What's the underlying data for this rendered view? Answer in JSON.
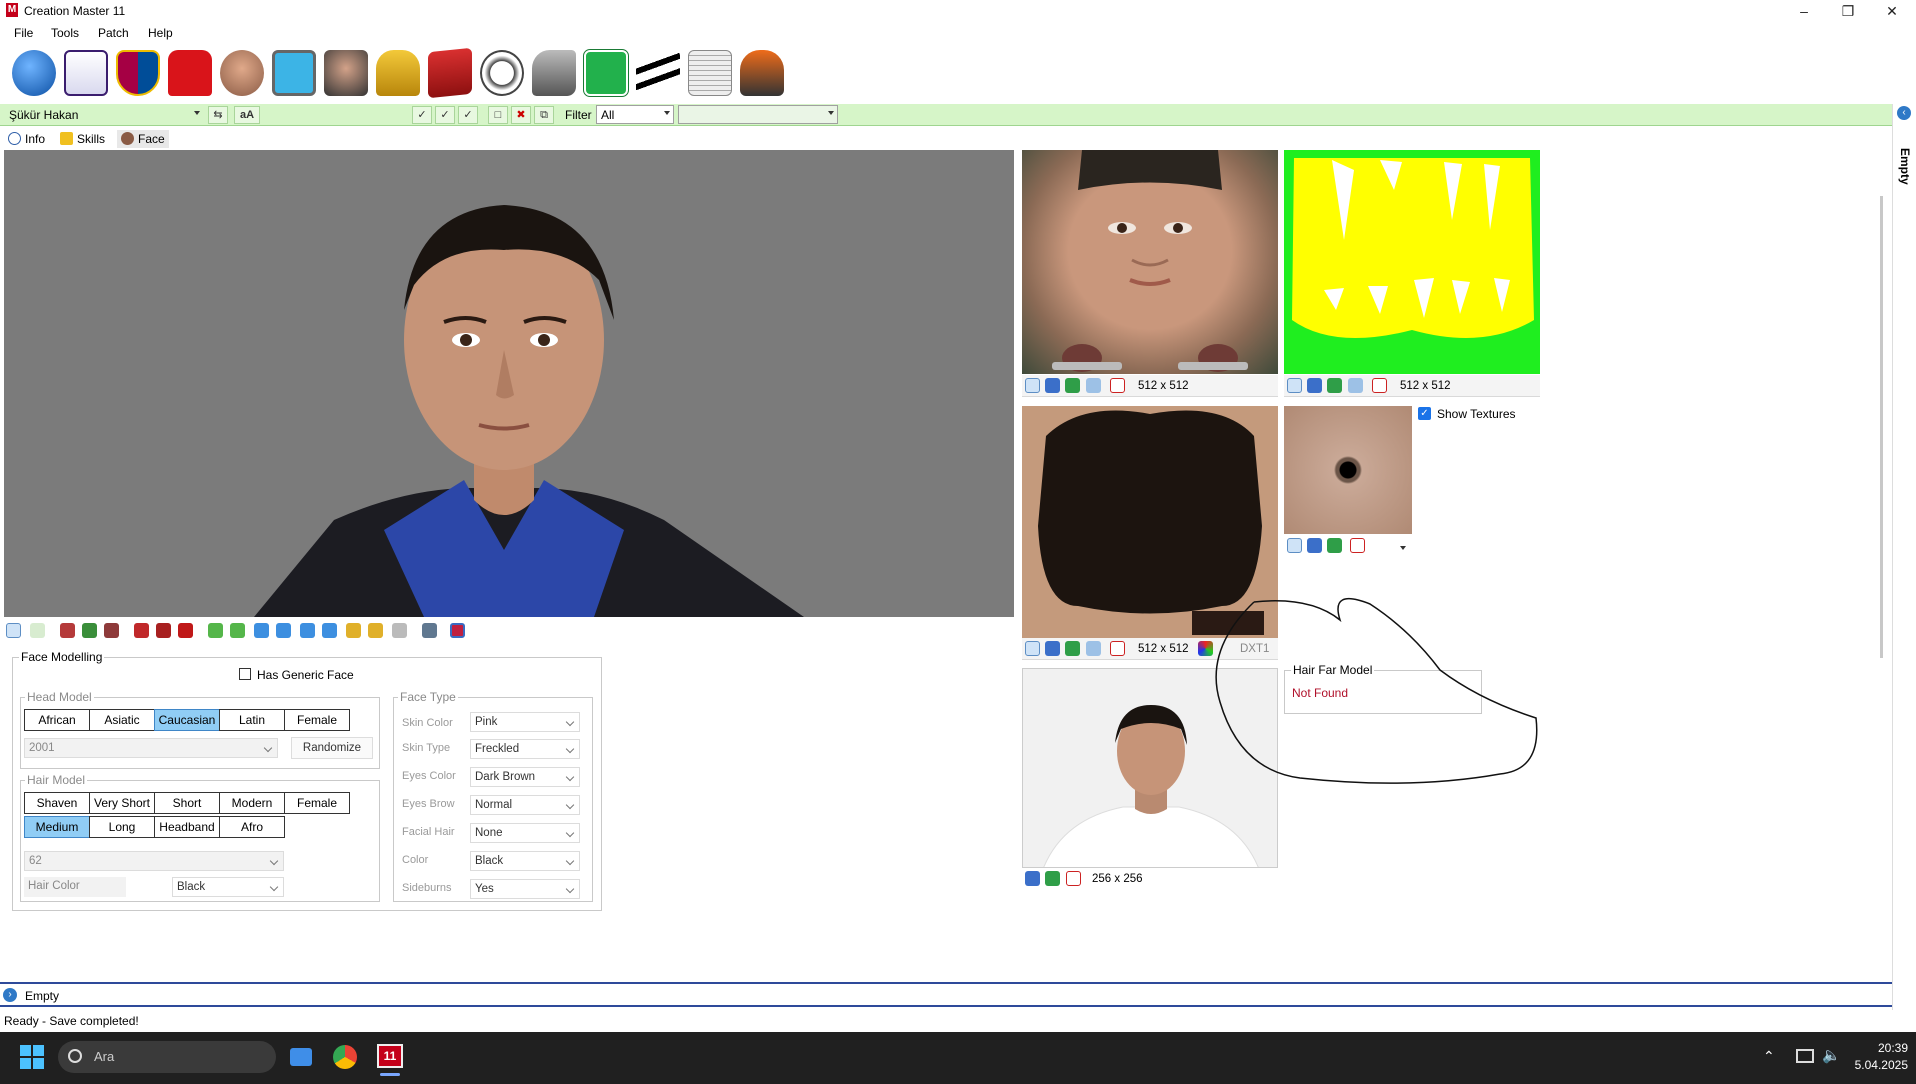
{
  "window": {
    "title": "Creation Master 11",
    "logo_letter": "M"
  },
  "menu": [
    "File",
    "Tools",
    "Patch",
    "Help"
  ],
  "toolbar_icons": [
    "globe-icon",
    "premier-league-icon",
    "fc-barcelona-icon",
    "jersey-icon",
    "player-icon",
    "stadium-icon",
    "manager-icon",
    "trophy-icon",
    "gamepad-icon",
    "cards-icon",
    "ball-icon",
    "boot-icon",
    "pitch-icon",
    "adidas-icon",
    "newspaper-icon",
    "goalkeeper-glove-icon"
  ],
  "filterbar": {
    "player": "Şükür Hakan",
    "font_btn": "aA",
    "filter_label": "Filter",
    "filter_value": "All",
    "extra_value": ""
  },
  "tabs": [
    {
      "label": "Info"
    },
    {
      "label": "Skills"
    },
    {
      "label": "Face"
    }
  ],
  "face_modelling": {
    "title": "Face Modelling",
    "generic_face_label": "Has Generic Face",
    "head_model": {
      "title": "Head Model",
      "options": [
        "African",
        "Asiatic",
        "Caucasian",
        "Latin",
        "Female"
      ],
      "selected": "Caucasian",
      "number": "2001",
      "randomize": "Randomize"
    },
    "hair_model": {
      "title": "Hair Model",
      "options_row1": [
        "Shaven",
        "Very Short",
        "Short",
        "Modern",
        "Female"
      ],
      "options_row2": [
        "Medium",
        "Long",
        "Headband",
        "Afro"
      ],
      "selected": "Medium",
      "number": "62",
      "color_label": "Hair Color",
      "color_value": "Black"
    },
    "face_type": {
      "title": "Face Type",
      "fields": [
        {
          "label": "Skin Color",
          "value": "Pink"
        },
        {
          "label": "Skin Type",
          "value": "Freckled"
        },
        {
          "label": "Eyes Color",
          "value": "Dark Brown"
        },
        {
          "label": "Eyes Brow",
          "value": "Normal"
        },
        {
          "label": "Facial Hair",
          "value": "None"
        },
        {
          "label": "Color",
          "value": "Black"
        },
        {
          "label": "Sideburns",
          "value": "Yes"
        }
      ]
    }
  },
  "textures": {
    "face_size": "512 x 512",
    "hair_mask_size": "512 x 512",
    "hair_size": "512 x 512",
    "hair_format": "DXT1",
    "photo_size": "256 x 256",
    "show_textures": "Show Textures"
  },
  "hair_far_model": {
    "title": "Hair Far Model",
    "status": "Not Found"
  },
  "bottom_tab": {
    "label": "Empty"
  },
  "right_rail": {
    "label": "Empty"
  },
  "status": {
    "text": "Ready - Save completed!"
  },
  "taskbar": {
    "search": "Ara",
    "time": "20:39",
    "date": "5.04.2025"
  },
  "colors": {
    "accent": "#90cdf5",
    "filter_bar": "#d6f5c8",
    "not_found": "#b0102a"
  }
}
